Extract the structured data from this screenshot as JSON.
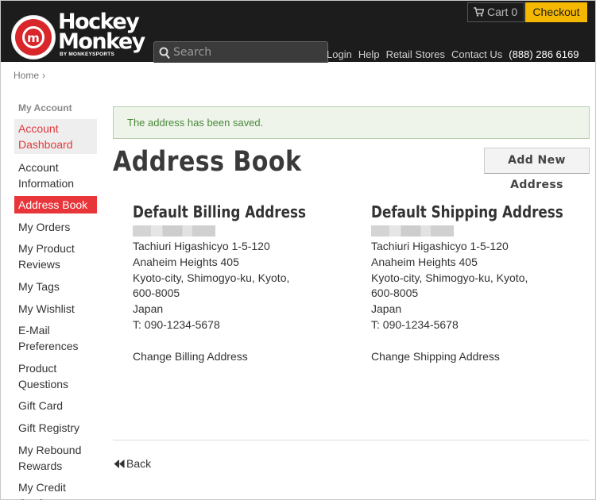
{
  "header": {
    "logo_line1": "Hockey",
    "logo_line2": "Monkey",
    "logo_sub": "BY MONKEYSPORTS",
    "search_placeholder": "Search",
    "links": [
      "Login",
      "Help",
      "Retail Stores",
      "Contact Us"
    ],
    "phone": "(888) 286 6169",
    "cart_label": "Cart 0",
    "checkout_label": "Checkout"
  },
  "breadcrumb": {
    "home": "Home",
    "separator": "›"
  },
  "sidebar": {
    "title": "My Account",
    "items": [
      {
        "label": "Account Dashboard"
      },
      {
        "label": "Account Information"
      },
      {
        "label": "Address Book"
      },
      {
        "label": "My Orders"
      },
      {
        "label": "My Product Reviews"
      },
      {
        "label": "My Tags"
      },
      {
        "label": "My Wishlist"
      },
      {
        "label": "E-Mail Preferences"
      },
      {
        "label": "Product Questions"
      },
      {
        "label": "Gift Card"
      },
      {
        "label": "Gift Registry"
      },
      {
        "label": "My Rebound Rewards"
      },
      {
        "label": "My Credit Cards"
      }
    ]
  },
  "main": {
    "notice": "The address has been saved.",
    "title": "Address Book",
    "add_button": "Add New Address",
    "billing": {
      "title": "Default Billing Address",
      "lines": [
        "Tachiuri Higashicyo 1-5-120",
        "Anaheim Heights 405",
        "Kyoto-city, Shimogyo-ku, Kyoto,",
        "600-8005",
        "Japan",
        "T: 090-1234-5678"
      ],
      "change_link": "Change Billing Address"
    },
    "shipping": {
      "title": "Default Shipping Address",
      "lines": [
        "Tachiuri Higashicyo 1-5-120",
        "Anaheim Heights 405",
        "Kyoto-city, Shimogyo-ku, Kyoto,",
        "600-8005",
        "Japan",
        "T: 090-1234-5678"
      ],
      "change_link": "Change Shipping Address"
    },
    "back_label": "Back"
  },
  "colors": {
    "header_bg": "#1c1c1c",
    "accent_red": "#e8353a",
    "checkout_yellow": "#f5b800",
    "notice_green": "#4a8a3a"
  }
}
